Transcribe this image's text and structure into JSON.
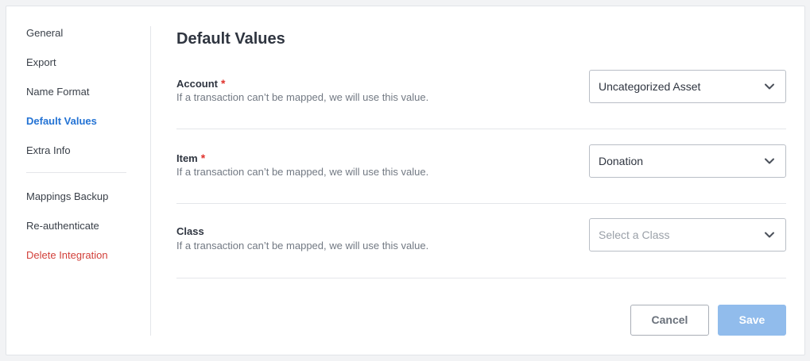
{
  "sidebar": {
    "items": [
      {
        "label": "General"
      },
      {
        "label": "Export"
      },
      {
        "label": "Name Format"
      },
      {
        "label": "Default Values",
        "active": true
      },
      {
        "label": "Extra Info"
      },
      {
        "label": "Mappings Backup"
      },
      {
        "label": "Re-authenticate"
      },
      {
        "label": "Delete Integration",
        "danger": true
      }
    ]
  },
  "main": {
    "title": "Default Values",
    "fields": [
      {
        "label": "Account",
        "required": true,
        "required_mark": "*",
        "help": "If a transaction can’t be mapped, we will use this value.",
        "value": "Uncategorized Asset",
        "is_placeholder": false
      },
      {
        "label": "Item",
        "required": true,
        "required_mark": "*",
        "help": "If a transaction can’t be mapped, we will use this value.",
        "value": "Donation",
        "is_placeholder": false
      },
      {
        "label": "Class",
        "required": false,
        "required_mark": "",
        "help": "If a transaction can’t be mapped, we will use this value.",
        "value": "Select a Class",
        "is_placeholder": true
      }
    ],
    "buttons": {
      "cancel_label": "Cancel",
      "save_label": "Save",
      "save_disabled": true
    }
  },
  "colors": {
    "accent": "#2473d4",
    "danger": "#d2403a",
    "required": "#e0322c",
    "save_disabled": "#91bcec"
  }
}
